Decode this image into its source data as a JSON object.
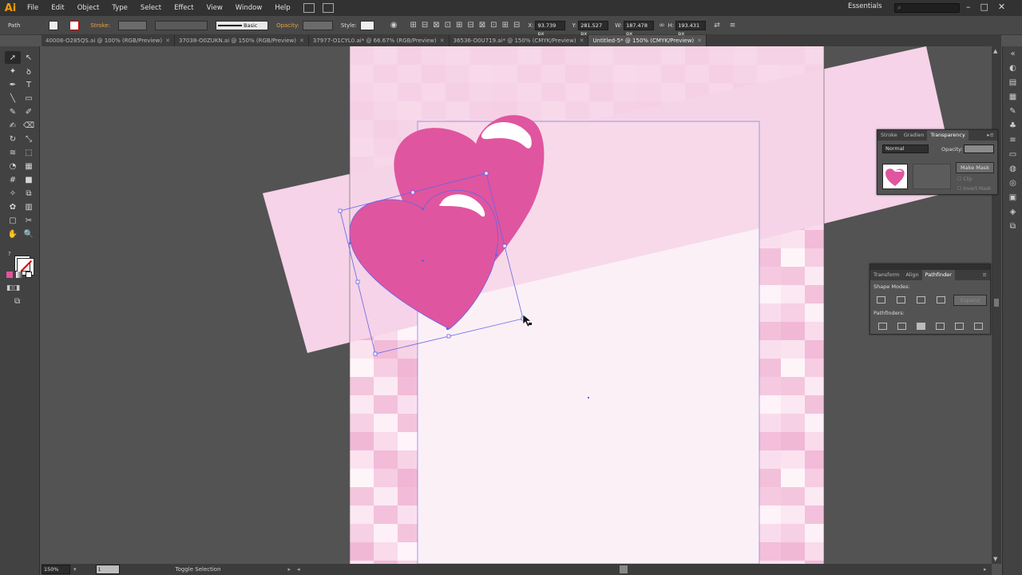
{
  "app": {
    "logo": "Ai",
    "menu": [
      "File",
      "Edit",
      "Object",
      "Type",
      "Select",
      "Effect",
      "View",
      "Window",
      "Help"
    ],
    "workspace": "Essentials",
    "window_controls": [
      "–",
      "□",
      "✕"
    ]
  },
  "control_bar": {
    "selection_type": "Path",
    "stroke_label": "Stroke:",
    "stroke_profile": "Basic",
    "opacity_label": "Opacity:",
    "style_label": "Style:",
    "x_label": "X:",
    "x_value": "93.739 px",
    "y_label": "Y:",
    "y_value": "281.527 px",
    "w_label": "W:",
    "w_value": "187.478 px",
    "h_label": "H:",
    "h_value": "193.431 px"
  },
  "tabs": [
    {
      "label": "40008-O285QS.ai @ 100% (RGB/Preview)",
      "active": false
    },
    {
      "label": "37038-O0ZUKN.ai @ 150% (RGB/Preview)",
      "active": false
    },
    {
      "label": "37977-O1CYL0.ai* @ 66.67% (RGB/Preview)",
      "active": false
    },
    {
      "label": "36536-O0U719.ai* @ 150% (CMYK/Preview)",
      "active": false
    },
    {
      "label": "Untitled-5* @ 150% (CMYK/Preview)",
      "active": true
    }
  ],
  "tools": [
    "selection-tool",
    "direct-selection-tool",
    "magic-wand-tool",
    "lasso-tool",
    "pen-tool",
    "type-tool",
    "line-tool",
    "rectangle-tool",
    "paintbrush-tool",
    "pencil-tool",
    "blob-brush-tool",
    "eraser-tool",
    "rotate-tool",
    "scale-tool",
    "width-tool",
    "free-transform-tool",
    "shape-builder-tool",
    "perspective-grid-tool",
    "mesh-tool",
    "gradient-tool",
    "eyedropper-tool",
    "blend-tool",
    "symbol-sprayer-tool",
    "column-graph-tool",
    "artboard-tool",
    "slice-tool",
    "hand-tool",
    "zoom-tool"
  ],
  "tool_glyphs": [
    "➚",
    "↖",
    "✦",
    "ꝺ",
    "✒",
    "T",
    "╲",
    "▭",
    "✎",
    "✐",
    "✍",
    "⌫",
    "↻",
    "⤡",
    "≋",
    "⬚",
    "◔",
    "▦",
    "#",
    "■",
    "✧",
    "⧉",
    "✿",
    "▥",
    "▢",
    "✂",
    "✋",
    "🔍"
  ],
  "status": {
    "zoom": "150%",
    "page": "1",
    "text": "Toggle Selection"
  },
  "transparency_panel": {
    "tabs": [
      "Stroke",
      "Gradien",
      "Transparency"
    ],
    "blend_mode": "Normal",
    "opacity_label": "Opacity:",
    "make_mask": "Make Mask",
    "clip": "Clip",
    "invert_mask": "Invert Mask"
  },
  "pathfinder_panel": {
    "tabs": [
      "Transform",
      "Align",
      "Pathfinder"
    ],
    "shape_modes": "Shape Modes:",
    "expand": "Expand",
    "pathfinders": "Pathfinders:"
  },
  "colors": {
    "heart": "#e0559f",
    "light_pink": "#f6d3e8",
    "artboard": "#fcf0f7",
    "selection": "#6464e8"
  }
}
